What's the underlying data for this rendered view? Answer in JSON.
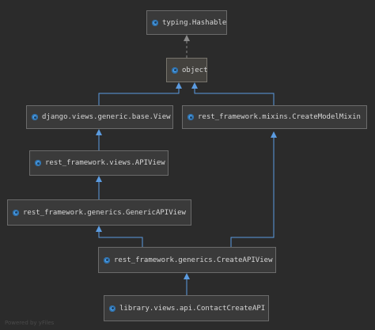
{
  "nodes": {
    "hashable": "typing.Hashable",
    "object": "object",
    "view": "django.views.generic.base.View",
    "create_model_mixin": "rest_framework.mixins.CreateModelMixin",
    "api_view": "rest_framework.views.APIView",
    "generic_api_view": "rest_framework.generics.GenericAPIView",
    "create_api_view": "rest_framework.generics.CreateAPIView",
    "contact_create_api": "library.views.api.ContactCreateAPI"
  },
  "icon": "class-icon",
  "colors": {
    "background": "#2b2b2b",
    "node_fill": "#3a3a3a",
    "node_border": "#6b6b6b",
    "node_text": "#d6d6d6",
    "inheritance_edge": "#5b9be0",
    "dashed_edge": "#8a8a8a",
    "class_icon": "#4a9ee8"
  },
  "watermark": "Powered by yFiles"
}
